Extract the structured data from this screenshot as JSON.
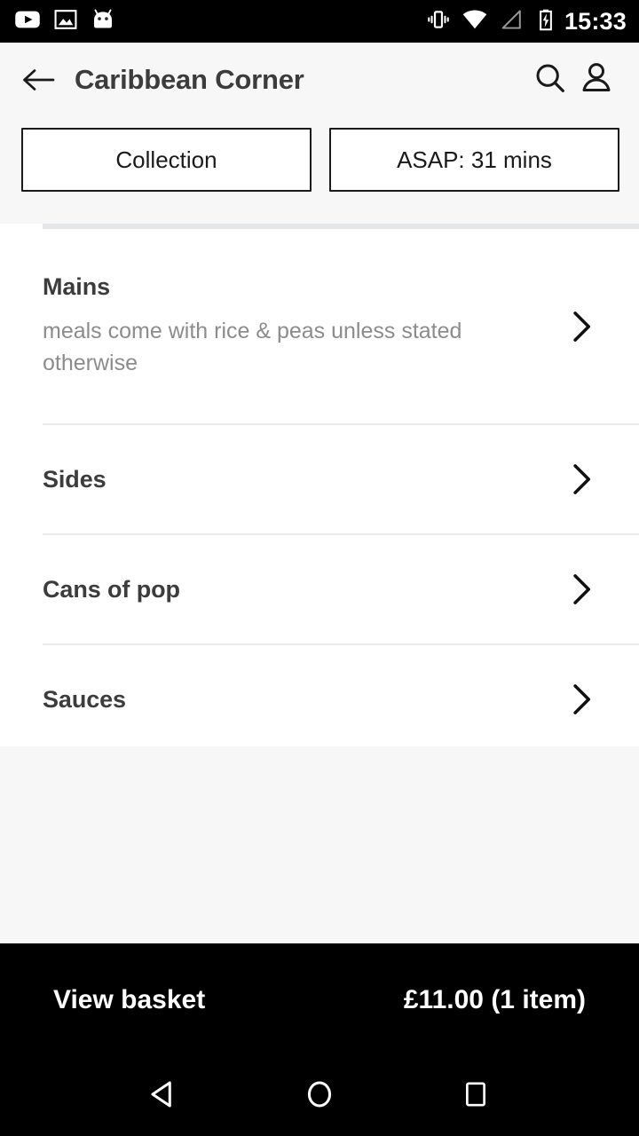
{
  "status_bar": {
    "left_icons": [
      {
        "name": "youtube-icon",
        "label": "YouTube"
      },
      {
        "name": "image-icon",
        "label": "Screenshot"
      },
      {
        "name": "android-robot-icon",
        "label": "Android System"
      }
    ],
    "right_icons": [
      {
        "name": "vibrate-icon",
        "label": "Vibrate"
      },
      {
        "name": "wifi-icon",
        "label": "Wi-Fi"
      },
      {
        "name": "cell-signal-icon",
        "label": "Signal"
      },
      {
        "name": "battery-charging-icon",
        "label": "Battery charging"
      }
    ],
    "clock": "15:33"
  },
  "header": {
    "back_label": "Back",
    "title": "Caribbean Corner",
    "search_label": "Search",
    "account_label": "Account"
  },
  "filters": {
    "fulfilment": "Collection",
    "timing": "ASAP: 31 mins"
  },
  "menu": {
    "categories": [
      {
        "title": "Mains",
        "subtitle": "meals come with rice & peas unless stated otherwise"
      },
      {
        "title": "Sides",
        "subtitle": ""
      },
      {
        "title": "Cans of pop",
        "subtitle": ""
      },
      {
        "title": "Sauces",
        "subtitle": ""
      }
    ]
  },
  "basket": {
    "label": "View basket",
    "total": "£11.00 (1 item)"
  },
  "nav_bar": {
    "back": "Back",
    "home": "Home",
    "recents": "Recent apps"
  },
  "colors": {
    "accent_black": "#000000",
    "page_background": "#f7f7f7",
    "surface": "#ffffff",
    "title_text": "#3c3c3c",
    "muted_text": "#8c8c8c",
    "divider": "#eaebec"
  }
}
